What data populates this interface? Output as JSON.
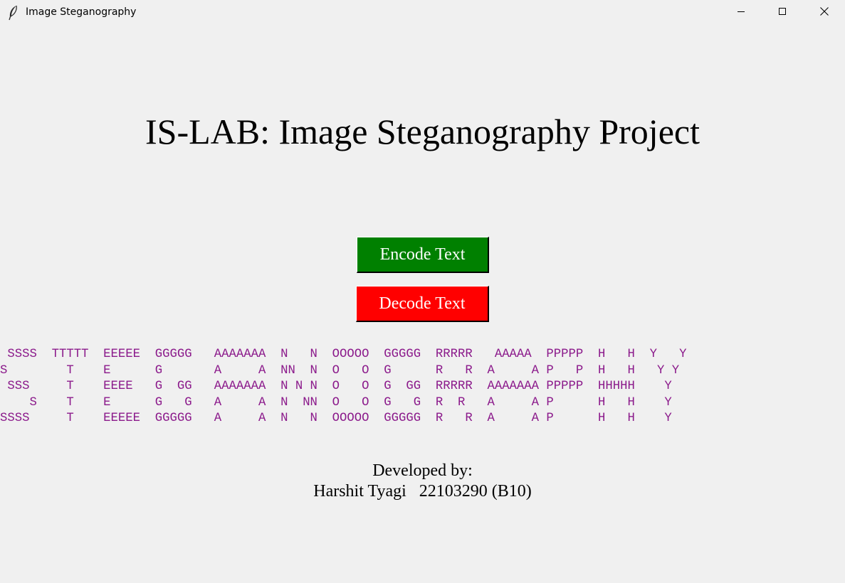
{
  "window": {
    "title": "Image Steganography",
    "app_icon": "feather-icon",
    "controls": {
      "minimize_icon": "minimize-icon",
      "maximize_icon": "maximize-icon",
      "close_icon": "close-icon"
    }
  },
  "main": {
    "heading": "IS-LAB: Image Steganography Project",
    "encode_button": {
      "label": "Encode Text",
      "color": "#008000"
    },
    "decode_button": {
      "label": "Decode Text",
      "color": "#ff0000"
    },
    "ascii_banner": {
      "color": "#8b1a8b",
      "lines": [
        " SSSS  TTTTT  EEEEE  GGGGG   AAAAAAA  N   N  OOOOO  GGGGG  RRRRR   AAAAA  PPPPP  H   H  Y   Y",
        "S        T    E      G       A     A  NN  N  O   O  G      R   R  A     A P   P  H   H   Y Y",
        " SSS     T    EEEE   G  GG   AAAAAAA  N N N  O   O  G  GG  RRRRR  AAAAAAA PPPPP  HHHHH    Y",
        "    S    T    E      G   G   A     A  N  NN  O   O  G   G  R  R   A     A P      H   H    Y",
        "SSSS     T    EEEEE  GGGGG   A     A  N   N  OOOOO  GGGGG  R   R  A     A P      H   H    Y"
      ]
    },
    "credits": {
      "line1": "Developed by:",
      "line2": "Harshit Tyagi   22103290 (B10)"
    }
  }
}
